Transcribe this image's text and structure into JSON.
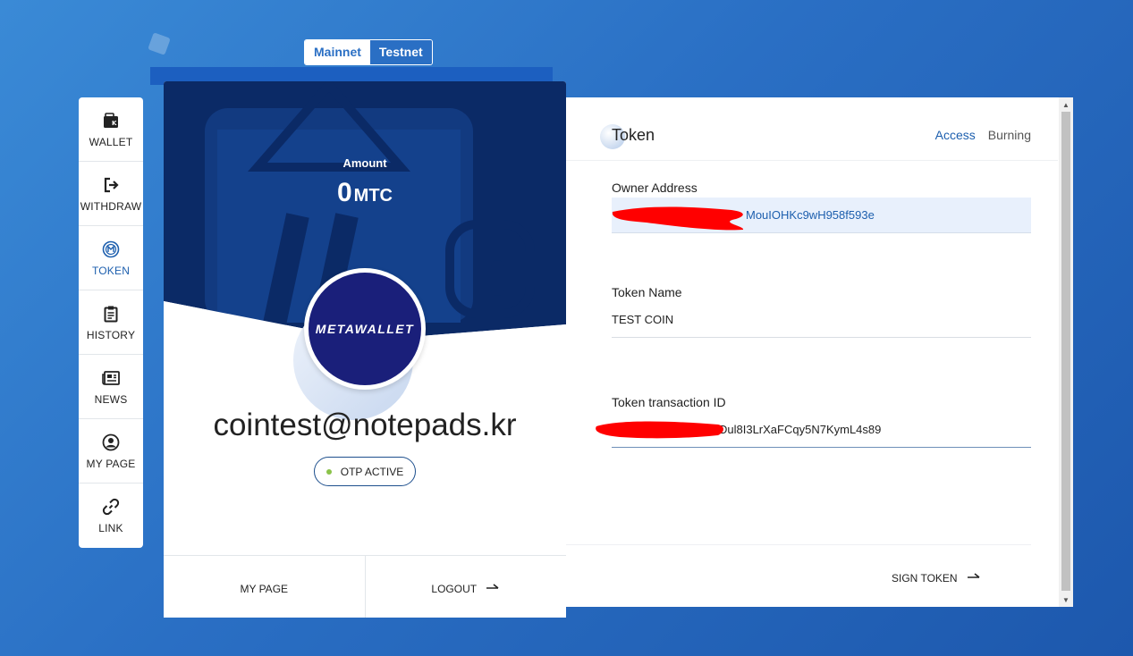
{
  "network": {
    "options": [
      "Mainnet",
      "Testnet"
    ],
    "selected": "Testnet"
  },
  "sidebar": {
    "items": [
      {
        "label": "WALLET",
        "icon": "wallet-icon",
        "active": false
      },
      {
        "label": "WITHDRAW",
        "icon": "withdraw-icon",
        "active": false
      },
      {
        "label": "TOKEN",
        "icon": "token-icon",
        "active": true
      },
      {
        "label": "HISTORY",
        "icon": "history-icon",
        "active": false
      },
      {
        "label": "NEWS",
        "icon": "news-icon",
        "active": false
      },
      {
        "label": "MY PAGE",
        "icon": "user-icon",
        "active": false
      },
      {
        "label": "LINK",
        "icon": "link-icon",
        "active": false
      }
    ]
  },
  "profile": {
    "amount_label": "Amount",
    "amount_value": "0",
    "amount_unit": "MTC",
    "logo_text": "METAWALLET",
    "email": "cointest@notepads.kr",
    "otp_status": "OTP ACTIVE",
    "footer": {
      "my_page": "MY PAGE",
      "logout": "LOGOUT"
    }
  },
  "token_panel": {
    "title": "Token",
    "tabs": [
      {
        "label": "Access",
        "active": true
      },
      {
        "label": "Burning",
        "active": false
      }
    ],
    "owner_address_label": "Owner Address",
    "owner_address_value": "MouIOHKc9wH958f593e",
    "token_name_label": "Token Name",
    "token_name_value": "TEST COIN",
    "txid_label": "Token transaction ID",
    "txid_value": "Dul8I3LrXaFCqy5N7KymL4s89",
    "sign_button": "SIGN TOKEN"
  },
  "colors": {
    "accent": "#1d5fae",
    "card_dark": "#0b2a66",
    "avatar_bg": "#1a1f7a",
    "otp_dot": "#8bc34a",
    "redaction": "#ff0000"
  }
}
